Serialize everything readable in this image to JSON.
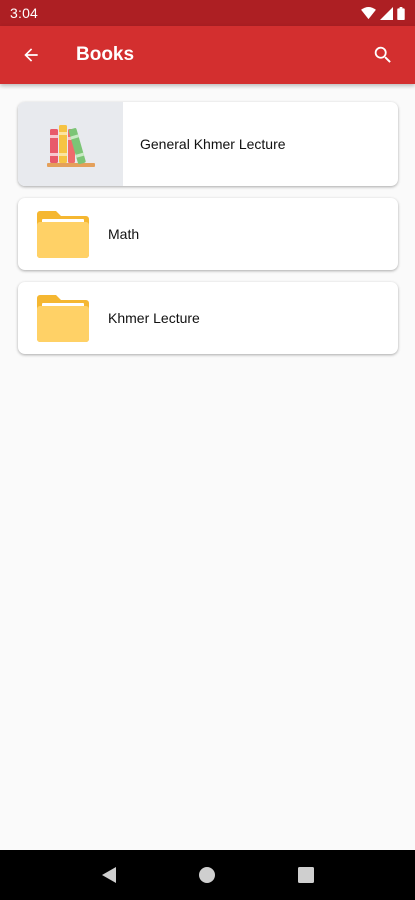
{
  "status_bar": {
    "time": "3:04"
  },
  "app_bar": {
    "title": "Books",
    "back_icon": "arrow-back-icon",
    "search_icon": "search-icon"
  },
  "items": [
    {
      "label": "General Khmer Lecture",
      "icon": "books-icon"
    },
    {
      "label": "Math",
      "icon": "folder-icon"
    },
    {
      "label": "Khmer Lecture",
      "icon": "folder-icon"
    }
  ],
  "colors": {
    "app_bar": "#d32f2f",
    "status_bar": "#ad1f23",
    "background": "#fafafa",
    "folder": "#ffd166"
  }
}
